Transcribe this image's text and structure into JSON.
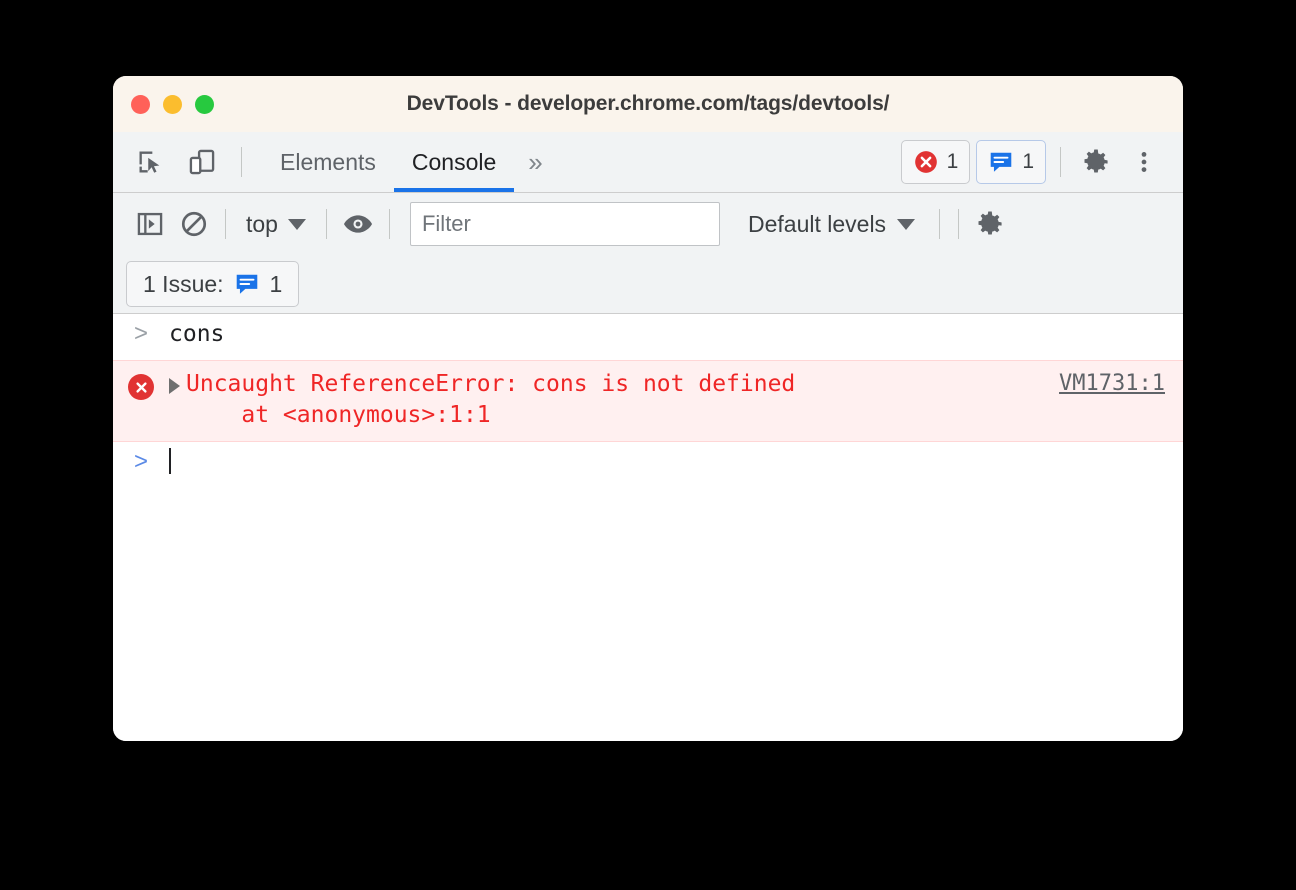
{
  "window": {
    "title": "DevTools - developer.chrome.com/tags/devtools/",
    "traffic_lights": {
      "close_color": "#ff6159",
      "minimize_color": "#fbbd2e",
      "maximize_color": "#27c93f"
    }
  },
  "tabbar": {
    "inspect_icon": "inspect-element-icon",
    "device_icon": "device-toolbar-icon",
    "tabs": [
      {
        "label": "Elements",
        "active": false
      },
      {
        "label": "Console",
        "active": true
      }
    ],
    "more_tabs_label": "»",
    "errors_count": "1",
    "issues_count": "1",
    "settings_icon": "gear-icon",
    "more_options_icon": "kebab-menu-icon",
    "active_tab_underline_color": "#1a73e8"
  },
  "console_toolbar": {
    "sidebar_toggle_icon": "console-sidebar-icon",
    "clear_console_icon": "clear-console-icon",
    "context_label": "top",
    "live_expression_icon": "eye-icon",
    "filter_placeholder": "Filter",
    "filter_value": "",
    "levels_label": "Default levels",
    "settings_icon": "gear-icon"
  },
  "issues_bar": {
    "label": "1 Issue:",
    "icon": "issue-icon",
    "count": "1"
  },
  "console": {
    "rows": [
      {
        "type": "input",
        "chevron": ">",
        "text": "cons"
      },
      {
        "type": "error",
        "icon": "error-circle-icon",
        "message": "Uncaught ReferenceError: cons is not defined\n    at <anonymous>:1:1",
        "source_link": "VM1731:1",
        "background": "#fff0f0",
        "text_color": "#ef2626"
      },
      {
        "type": "prompt",
        "chevron": ">",
        "text": ""
      }
    ]
  }
}
